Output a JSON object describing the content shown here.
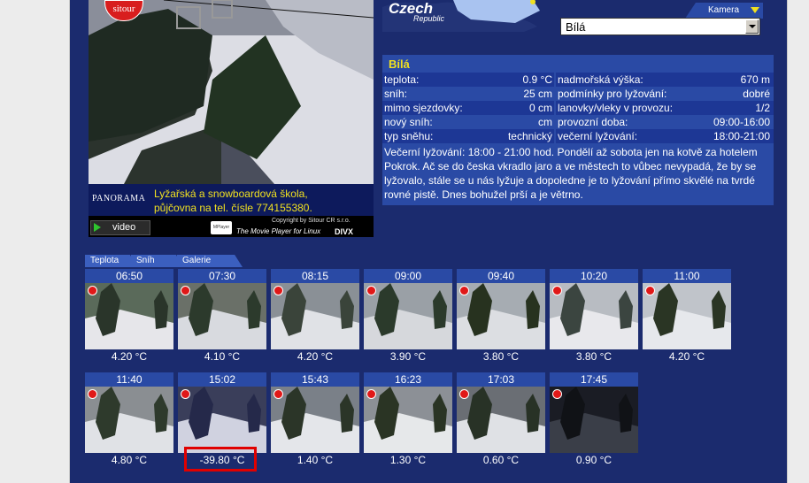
{
  "camera": {
    "logo": "sitour",
    "brand": "PANORAMA",
    "school_line1": "Lyžařská a snowboardová škola,",
    "school_line2": "půjčovna na tel. čísle 774155380.",
    "video_label": "video",
    "copyright": "Copyright by Sitour CR s.r.o.",
    "player_logo": "MPlayer",
    "player_tagline": "The Movie Player for Linux",
    "divx": "DIVX"
  },
  "header": {
    "country": "Czech",
    "country_sub": "Republic",
    "camera_tab": "Kamera",
    "camera_select": "Bílá"
  },
  "info": {
    "title": "Bílá",
    "left": [
      {
        "label": "teplota:",
        "value": "0.9 °C"
      },
      {
        "label": "sníh:",
        "value": "25 cm"
      },
      {
        "label": "mimo sjezdovky:",
        "value": "0 cm"
      },
      {
        "label": "nový sníh:",
        "value": "cm"
      },
      {
        "label": "typ sněhu:",
        "value": "technický"
      }
    ],
    "right": [
      {
        "label": "nadmořská výška:",
        "value": "670 m"
      },
      {
        "label": "podmínky pro lyžování:",
        "value": "dobré"
      },
      {
        "label": "lanovky/vleky v provozu:",
        "value": "1/2"
      },
      {
        "label": "provozní doba:",
        "value": "09:00-16:00"
      },
      {
        "label": "večerní lyžování:",
        "value": "18:00-21:00"
      }
    ],
    "description": "Večerní lyžování: 18:00 - 21:00 hod. Pondělí až sobota jen na kotvě za hotelem Pokrok. Ač se do česka vkradlo jaro a ve městech to vůbec nevypadá, že by se lyžovalo, stále se u nás lyžuje a dopoledne je to lyžování přímo skvělé na tvrdé rovné pistě. Dnes bohužel prší a je větrno."
  },
  "tabs": [
    "Teplota",
    "Sníh",
    "Galerie"
  ],
  "thumbnails": [
    {
      "time": "06:50",
      "temp": "4.20 °C"
    },
    {
      "time": "07:30",
      "temp": "4.10 °C"
    },
    {
      "time": "08:15",
      "temp": "4.20 °C"
    },
    {
      "time": "09:00",
      "temp": "3.90 °C"
    },
    {
      "time": "09:40",
      "temp": "3.80 °C"
    },
    {
      "time": "10:20",
      "temp": "3.80 °C"
    },
    {
      "time": "11:00",
      "temp": "4.20 °C"
    },
    {
      "time": "11:40",
      "temp": "4.80 °C"
    },
    {
      "time": "15:02",
      "temp": "-39.80 °C"
    },
    {
      "time": "15:43",
      "temp": "1.40 °C"
    },
    {
      "time": "16:23",
      "temp": "1.30 °C"
    },
    {
      "time": "17:03",
      "temp": "0.60 °C"
    },
    {
      "time": "17:45",
      "temp": "0.90 °C"
    }
  ]
}
